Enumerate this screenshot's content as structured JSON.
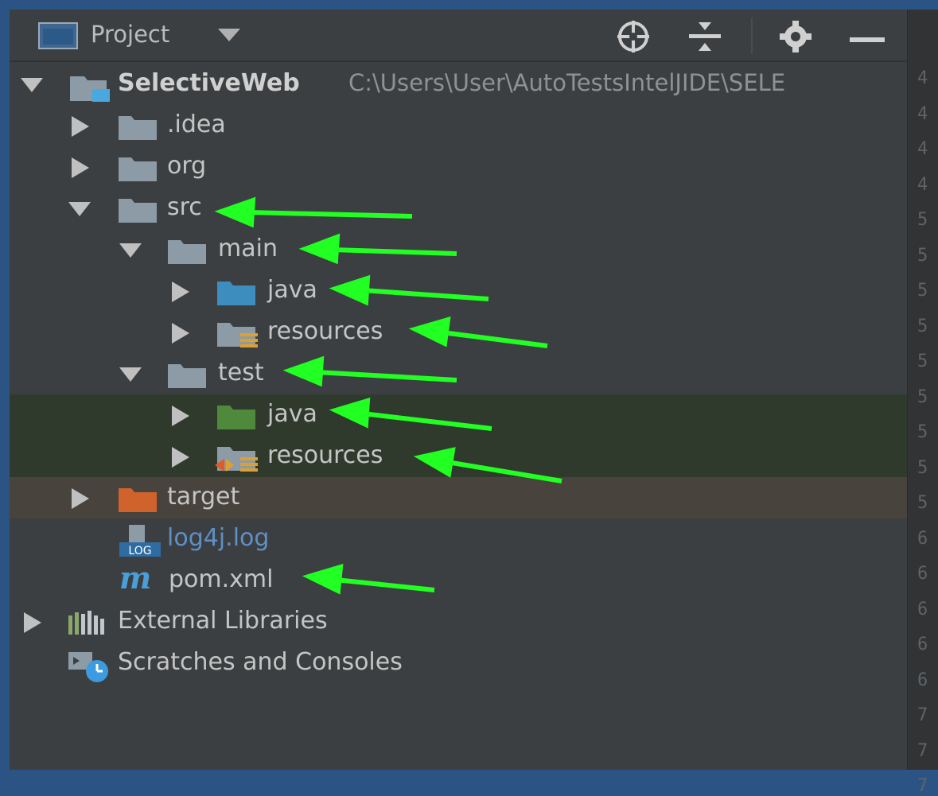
{
  "panel": {
    "title": "Project",
    "toolbar_icons": [
      "dropdown-caret-icon",
      "locate-crosshair-icon",
      "collapse-all-icon",
      "gear-icon",
      "minimize-icon"
    ]
  },
  "tree": {
    "root": {
      "name": "SelectiveWeb",
      "path": "C:\\Users\\User\\AutoTestsIntelJIDE\\SELE"
    },
    "items": [
      {
        "label": ".idea"
      },
      {
        "label": "org"
      },
      {
        "label": "src"
      },
      {
        "label": "main"
      },
      {
        "label": "java"
      },
      {
        "label": "resources"
      },
      {
        "label": "test"
      },
      {
        "label": "java"
      },
      {
        "label": "resources"
      },
      {
        "label": "target"
      },
      {
        "label": "log4j.log"
      },
      {
        "label": "pom.xml"
      },
      {
        "label": "External Libraries"
      },
      {
        "label": "Scratches and Consoles"
      }
    ]
  },
  "gutter": {
    "line_numbers": [
      "4",
      "4",
      "4",
      "4",
      "5",
      "5",
      "5",
      "5",
      "5",
      "5",
      "5",
      "5",
      "5",
      "6",
      "6",
      "6",
      "6",
      "6",
      "7",
      "7",
      "7"
    ]
  },
  "colors": {
    "annotation_arrow": "#22ff22",
    "folder": "#8c9ba5",
    "source_folder": "#3d8dbf",
    "test_folder": "#4f8a3c",
    "excluded_folder": "#d0632c",
    "selection_green": "#2f3a2d",
    "selection_brown": "#48433d"
  }
}
